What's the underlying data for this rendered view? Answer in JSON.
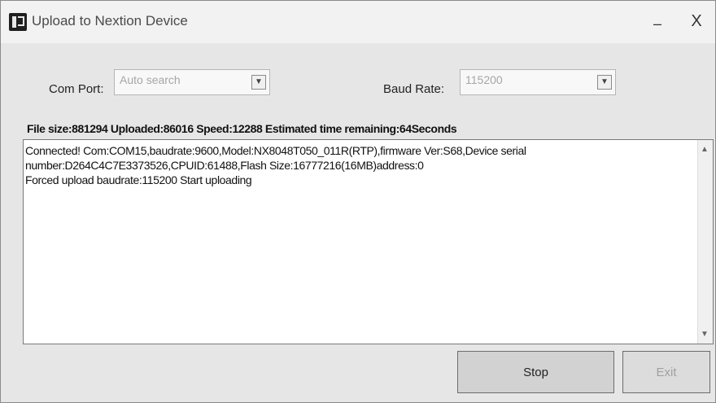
{
  "window": {
    "title": "Upload to Nextion Device",
    "minimize_glyph": "–",
    "close_glyph": "X"
  },
  "com_port": {
    "label": "Com Port:",
    "value": "Auto search"
  },
  "baud_rate": {
    "label": "Baud Rate:",
    "value": "115200"
  },
  "status_line": "File size:881294 Uploaded:86016 Speed:12288 Estimated time remaining:64Seconds",
  "log": {
    "line1": "Connected! Com:COM15,baudrate:9600,Model:NX8048T050_011R(RTP),firmware Ver:S68,Device serial",
    "line2": "number:D264C4C7E3373526,CPUID:61488,Flash Size:16777216(16MB)address:0",
    "line3": "Forced upload baudrate:115200  Start uploading"
  },
  "buttons": {
    "stop": "Stop",
    "exit": "Exit"
  },
  "icons": {
    "app": "nextion-logo-icon",
    "dropdown": "chevron-down-icon"
  }
}
